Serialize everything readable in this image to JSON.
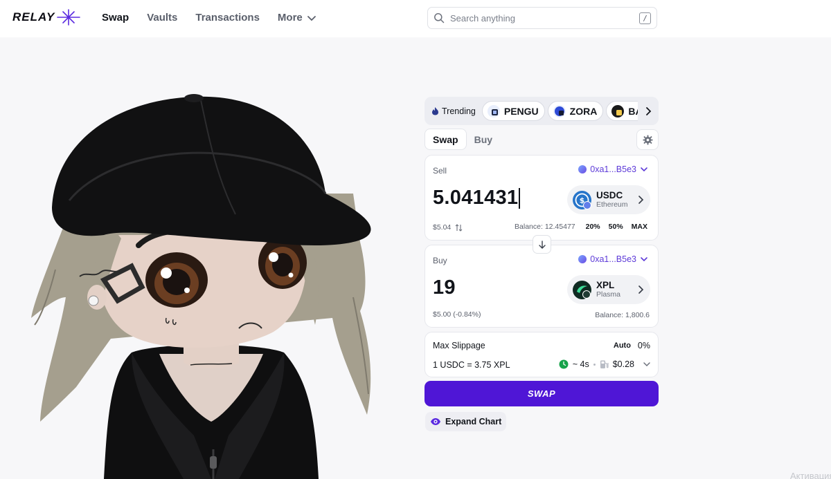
{
  "brand": {
    "name": "RELAY"
  },
  "nav": {
    "items": [
      {
        "label": "Swap",
        "active": true
      },
      {
        "label": "Vaults",
        "active": false
      },
      {
        "label": "Transactions",
        "active": false
      },
      {
        "label": "More",
        "active": false
      }
    ]
  },
  "search": {
    "placeholder": "Search anything",
    "shortcut": "/"
  },
  "trending": {
    "label": "Trending",
    "tokens": [
      {
        "symbol": "PENGU"
      },
      {
        "symbol": "ZORA"
      },
      {
        "symbol": "BA"
      }
    ]
  },
  "widget": {
    "tabs": [
      {
        "label": "Swap",
        "active": true
      },
      {
        "label": "Buy",
        "active": false
      }
    ],
    "sell": {
      "label": "Sell",
      "wallet": "0xa1...B5e3",
      "amount": "5.041431",
      "usd": "$5.04",
      "token": {
        "symbol": "USDC",
        "chain": "Ethereum"
      },
      "balance": "Balance: 12.45477",
      "percent_buttons": [
        "20%",
        "50%",
        "MAX"
      ]
    },
    "buy": {
      "label": "Buy",
      "wallet": "0xa1...B5e3",
      "amount": "19",
      "usd": "$5.00 (-0.84%)",
      "token": {
        "symbol": "XPL",
        "chain": "Plasma"
      },
      "balance": "Balance: 1,800.6"
    },
    "slippage": {
      "label": "Max Slippage",
      "mode": "Auto",
      "value": "0%",
      "rate": "1 USDC = 3.75 XPL",
      "time": "~ 4s",
      "fee": "$0.28"
    },
    "swap_button": "SWAP",
    "expand_chart": "Expand Chart"
  },
  "watermark": "Активация Windows",
  "colors": {
    "accent": "#4f16d6",
    "wallet_link": "#5d3ad8",
    "time_green": "#17a34a"
  }
}
